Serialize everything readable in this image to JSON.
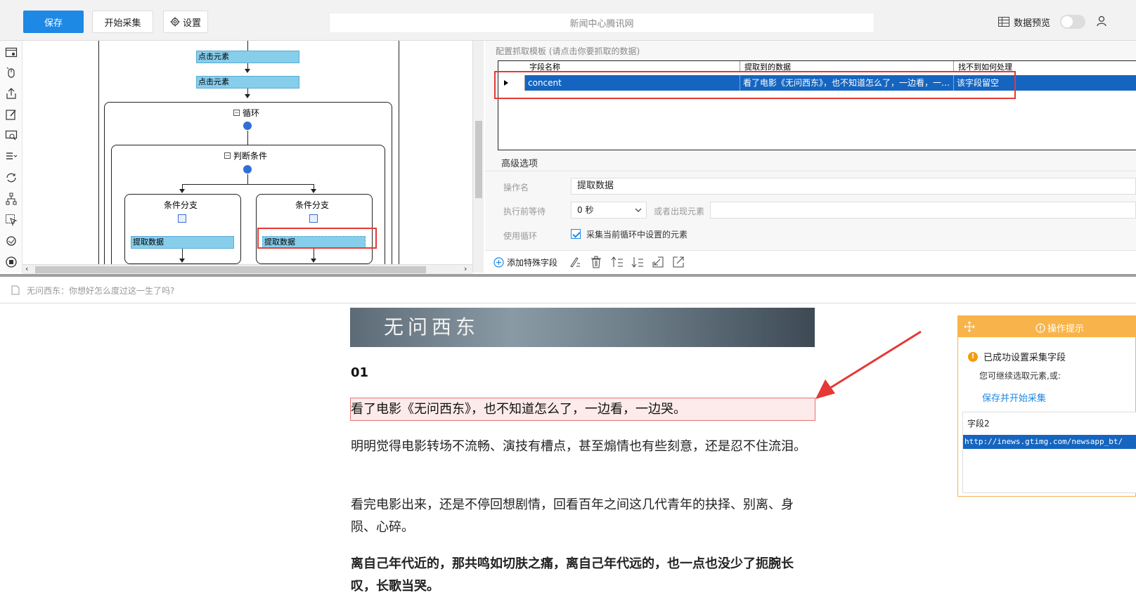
{
  "toolbar": {
    "save_label": "保存",
    "start_label": "开始采集",
    "settings_label": "设置",
    "page_title": "新闻中心腾讯网",
    "preview_label": "数据预览"
  },
  "workflow": {
    "node_click_1": "点击元素",
    "node_click_2": "点击元素",
    "loop_label": "循环",
    "judge_label": "判断条件",
    "branch_left_label": "条件分支",
    "branch_right_label": "条件分支",
    "extract_left": "提取数据",
    "extract_right": "提取数据"
  },
  "config": {
    "title": "配置抓取模板 (请点击你要抓取的数据)",
    "columns": [
      "字段名称",
      "提取到的数据",
      "找不到如何处理"
    ],
    "row": {
      "field": "concent",
      "data": "看了电影《无问西东》，也不知道怎么了，一边看，一…",
      "handling": "该字段留空"
    },
    "advanced_title": "高级选项",
    "op_name_label": "操作名",
    "op_name_value": "提取数据",
    "wait_label": "执行前等待",
    "wait_value": "0 秒",
    "or_element_label": "或者出现元素",
    "loop_label": "使用循环",
    "loop_checkbox_text": "采集当前循环中设置的元素",
    "add_special_field": "添加特殊字段"
  },
  "address": {
    "text": "无问西东：你想好怎么度过这一生了吗?"
  },
  "article": {
    "banner_title": "无问西东",
    "number": "01",
    "highlight": "看了电影《无问西东》，也不知道怎么了，一边看，一边哭。",
    "para1": "明明觉得电影转场不流畅、演技有槽点，甚至煽情也有些刻意，还是忍不住流泪。",
    "para2": "看完电影出来，还是不停回想剧情，回看百年之间这几代青年的抉择、别离、身陨、心碎。",
    "para3": "离自己年代近的，那共鸣如切肤之痛，离自己年代远的，也一点也没少了扼腕长叹，长歌当哭。"
  },
  "tip": {
    "header": "操作提示",
    "success": "已成功设置采集字段",
    "continue_text": "您可继续选取元素,或:",
    "save_start_link": "保存并开始采集",
    "list_item1": "字段2",
    "list_item2": "http://inews.gtimg.com/newsapp_bt/"
  },
  "colors": {
    "primary": "#1e88e5",
    "selection": "#1565c0",
    "node": "#87ceeb",
    "highlight_red": "#e53935",
    "tip_orange": "#f8b44a"
  }
}
